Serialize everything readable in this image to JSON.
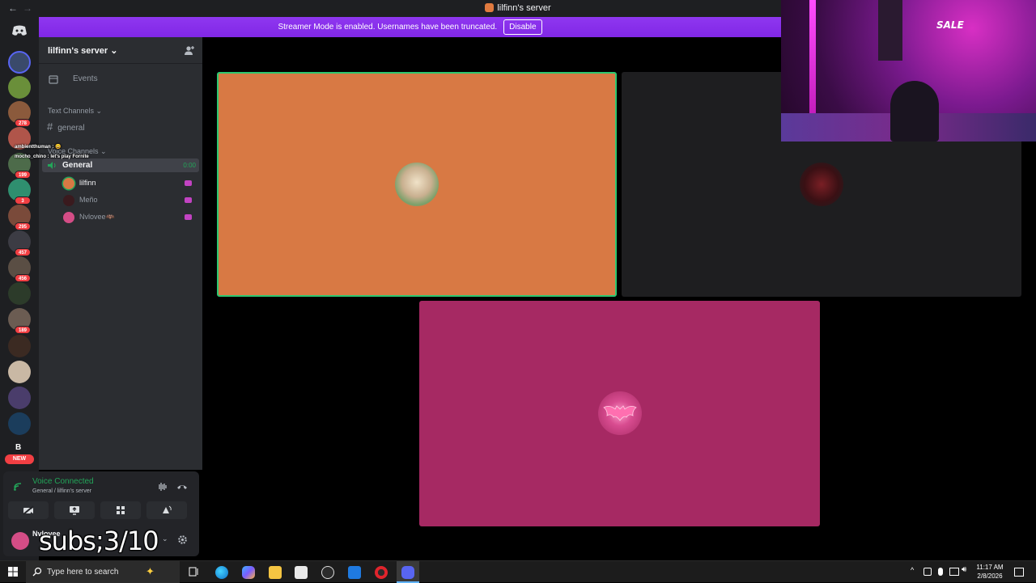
{
  "titlebar": {
    "title": "lilfinn's server"
  },
  "banner": {
    "message": "Streamer Mode is enabled. Usernames have been truncated.",
    "disable_label": "Disable"
  },
  "rail": {
    "badges": [
      "278",
      "199",
      "3",
      "295",
      "457",
      "456",
      "189"
    ],
    "letter": "B",
    "new_label": "NEW"
  },
  "sidebar": {
    "server_name": "lilfinn's server",
    "events_label": "Events",
    "text_category": "Text Channels",
    "text_channel": "general",
    "voice_category": "Voice Channels",
    "voice_channel": "General",
    "voice_timer": "0:00",
    "members": [
      {
        "name": "lilfinn",
        "color": "#3ba55d"
      },
      {
        "name": "Meño",
        "color": "#3a1a1e"
      },
      {
        "name": "Nvlovee🦇",
        "color": "#d44d86"
      }
    ]
  },
  "chat_overlay": {
    "line1": "ambientthuman : 😀",
    "line2": "mocho_chino : let's play Fornite"
  },
  "voice_panel": {
    "status": "Voice Connected",
    "location": "General / lilfinn's server",
    "username": "Nvlovee"
  },
  "stream_overlay": {
    "subs": "subs;3/10"
  },
  "webcam": {
    "sign_text": "SALE"
  },
  "taskbar": {
    "search_placeholder": "Type here to search",
    "time": "11:17 AM",
    "date": "2/8/2026"
  },
  "colors": {
    "tile_orange": "#d87944",
    "tile_dark": "#1e1e20",
    "tile_pink": "#a62963",
    "banner_purple": "#8a2be2",
    "speaking_green": "#2dc770"
  }
}
